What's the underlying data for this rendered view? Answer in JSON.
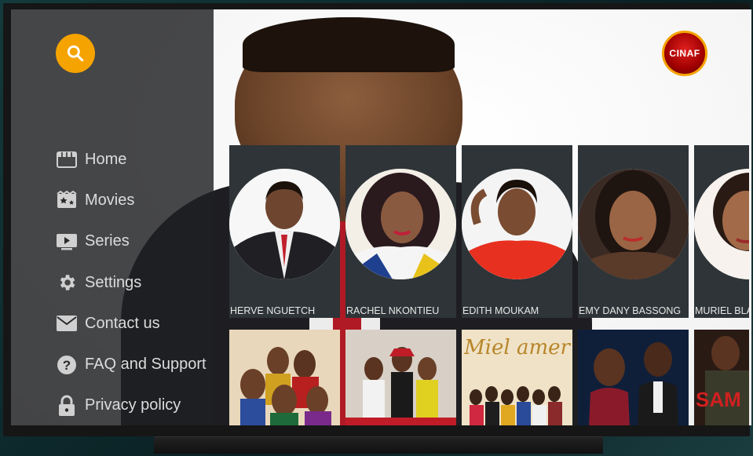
{
  "app": {
    "logo_text": "CINAF"
  },
  "sidebar": {
    "search_icon": "search-icon",
    "items": [
      {
        "label": "Home",
        "icon": "home-icon"
      },
      {
        "label": "Movies",
        "icon": "movies-icon"
      },
      {
        "label": "Series",
        "icon": "series-icon"
      },
      {
        "label": "Settings",
        "icon": "gear-icon"
      },
      {
        "label": "Contact us",
        "icon": "mail-icon"
      },
      {
        "label": "FAQ and Support",
        "icon": "help-icon"
      },
      {
        "label": "Privacy policy",
        "icon": "lock-icon"
      }
    ]
  },
  "actors": [
    {
      "name": "HERVE NGUETCH"
    },
    {
      "name": "RACHEL NKONTIEU"
    },
    {
      "name": "EDITH MOUKAM"
    },
    {
      "name": "EMY DANY BASSONG"
    },
    {
      "name": "MURIEL BLAN"
    }
  ],
  "movies": [
    {
      "title": ""
    },
    {
      "title": ""
    },
    {
      "title": "Miel amer"
    },
    {
      "title": ""
    },
    {
      "title": "SAM"
    }
  ],
  "colors": {
    "accent": "#f5a300",
    "card_bg": "#2e3437",
    "sidebar_bg": "#1e2022"
  }
}
